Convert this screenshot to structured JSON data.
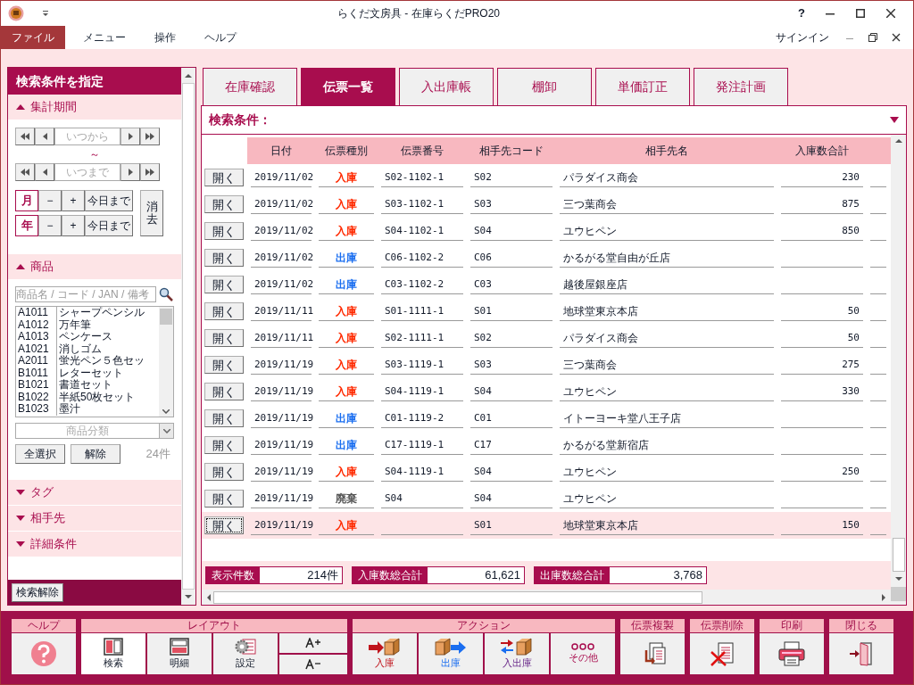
{
  "window": {
    "title": "らくだ文房具 - 在庫らくだPRO20",
    "help": "?"
  },
  "menu": [
    {
      "label": "ファイル",
      "selected": true
    },
    {
      "label": "メニュー",
      "selected": false
    },
    {
      "label": "操作",
      "selected": false
    },
    {
      "label": "ヘルプ",
      "selected": false
    }
  ],
  "signin": "サインイン",
  "sidebar": {
    "title": "検索条件を指定",
    "period": {
      "label": "集計期間",
      "expanded": true,
      "from_placeholder": "いつから",
      "tilde": "～",
      "to_placeholder": "いつまで",
      "units": [
        {
          "label": "月",
          "minus": "−",
          "plus": "+",
          "today": "今日まで"
        },
        {
          "label": "年",
          "minus": "−",
          "plus": "+",
          "today": "今日まで"
        }
      ],
      "clear": "消去"
    },
    "products": {
      "label": "商品",
      "expanded": true,
      "search_placeholder": "商品名 / コード / JAN / 備考",
      "items": [
        {
          "code": "A1011",
          "name": "シャープペンシル"
        },
        {
          "code": "A1012",
          "name": "万年筆"
        },
        {
          "code": "A1013",
          "name": "ペンケース"
        },
        {
          "code": "A1021",
          "name": "消しゴム"
        },
        {
          "code": "A2011",
          "name": "蛍光ペン５色セッ"
        },
        {
          "code": "B1011",
          "name": "レターセット"
        },
        {
          "code": "B1021",
          "name": "書道セット"
        },
        {
          "code": "B1022",
          "name": "半紙50枚セット"
        },
        {
          "code": "B1023",
          "name": "墨汁"
        }
      ],
      "category_placeholder": "商品分類",
      "select_all": "全選択",
      "deselect": "解除",
      "count": "24件"
    },
    "sections": [
      {
        "label": "タグ",
        "expanded": false
      },
      {
        "label": "相手先",
        "expanded": false
      },
      {
        "label": "詳細条件",
        "expanded": false
      }
    ],
    "reset": "検索解除"
  },
  "tabs": [
    {
      "label": "在庫確認",
      "selected": false
    },
    {
      "label": "伝票一覧",
      "selected": true
    },
    {
      "label": "入出庫帳",
      "selected": false
    },
    {
      "label": "棚卸",
      "selected": false
    },
    {
      "label": "単価訂正",
      "selected": false
    },
    {
      "label": "発注計画",
      "selected": false
    }
  ],
  "search_bar": {
    "label": "検索条件："
  },
  "table": {
    "columns": [
      "日付",
      "伝票種別",
      "伝票番号",
      "相手先コード",
      "相手先名",
      "入庫数合計"
    ],
    "rows": [
      {
        "open": "開く",
        "date": "2019/11/02",
        "type": "入庫",
        "kind": "in",
        "number": "S02-1102-1",
        "code": "S02",
        "name": "パラダイス商会",
        "qty": "230",
        "selected": false
      },
      {
        "open": "開く",
        "date": "2019/11/02",
        "type": "入庫",
        "kind": "in",
        "number": "S03-1102-1",
        "code": "S03",
        "name": "三つ葉商会",
        "qty": "875",
        "selected": false
      },
      {
        "open": "開く",
        "date": "2019/11/02",
        "type": "入庫",
        "kind": "in",
        "number": "S04-1102-1",
        "code": "S04",
        "name": "ユウヒペン",
        "qty": "850",
        "selected": false
      },
      {
        "open": "開く",
        "date": "2019/11/02",
        "type": "出庫",
        "kind": "out",
        "number": "C06-1102-2",
        "code": "C06",
        "name": "かるがる堂自由が丘店",
        "selected": false
      },
      {
        "open": "開く",
        "date": "2019/11/02",
        "type": "出庫",
        "kind": "out",
        "number": "C03-1102-2",
        "code": "C03",
        "name": "越後屋銀座店",
        "selected": false
      },
      {
        "open": "開く",
        "date": "2019/11/11",
        "type": "入庫",
        "kind": "in",
        "number": "S01-1111-1",
        "code": "S01",
        "name": "地球堂東京本店",
        "qty": "50",
        "selected": false
      },
      {
        "open": "開く",
        "date": "2019/11/11",
        "type": "入庫",
        "kind": "in",
        "number": "S02-1111-1",
        "code": "S02",
        "name": "パラダイス商会",
        "qty": "50",
        "selected": false
      },
      {
        "open": "開く",
        "date": "2019/11/19",
        "type": "入庫",
        "kind": "in",
        "number": "S03-1119-1",
        "code": "S03",
        "name": "三つ葉商会",
        "qty": "275",
        "selected": false
      },
      {
        "open": "開く",
        "date": "2019/11/19",
        "type": "入庫",
        "kind": "in",
        "number": "S04-1119-1",
        "code": "S04",
        "name": "ユウヒペン",
        "qty": "330",
        "selected": false
      },
      {
        "open": "開く",
        "date": "2019/11/19",
        "type": "出庫",
        "kind": "out",
        "number": "C01-1119-2",
        "code": "C01",
        "name": "イトーヨーキ堂八王子店",
        "selected": false
      },
      {
        "open": "開く",
        "date": "2019/11/19",
        "type": "出庫",
        "kind": "out",
        "number": "C17-1119-1",
        "code": "C17",
        "name": "かるがる堂新宿店",
        "selected": false
      },
      {
        "open": "開く",
        "date": "2019/11/19",
        "type": "入庫",
        "kind": "in",
        "number": "S04-1119-1",
        "code": "S04",
        "name": "ユウヒペン",
        "qty": "250",
        "selected": false
      },
      {
        "open": "開く",
        "date": "2019/11/19",
        "type": "廃棄",
        "kind": "discard",
        "number": "S04",
        "code": "S04",
        "name": "ユウヒペン",
        "selected": false
      },
      {
        "open": "開く",
        "date": "2019/11/19",
        "type": "入庫",
        "kind": "in",
        "code": "S01",
        "name": "地球堂東京本店",
        "qty": "150",
        "selected": true
      }
    ]
  },
  "totals": [
    {
      "label": "表示件数",
      "value": "214件"
    },
    {
      "label": "入庫数総合計",
      "value": "61,621"
    },
    {
      "label": "出庫数総合計",
      "value": "3,768"
    }
  ],
  "toolbar": [
    {
      "title": "ヘルプ",
      "buttons": [
        {
          "kind": "help"
        }
      ]
    },
    {
      "title": "レイアウト",
      "buttons": [
        {
          "kind": "search",
          "label": "検索",
          "selected": true
        },
        {
          "kind": "detail",
          "label": "明細",
          "selected": false
        },
        {
          "kind": "settings",
          "label": "設定",
          "selected": false
        },
        {
          "kind": "font"
        }
      ]
    },
    {
      "title": "アクション",
      "buttons": [
        {
          "kind": "in",
          "label": "入庫"
        },
        {
          "kind": "out",
          "label": "出庫"
        },
        {
          "kind": "inout",
          "label": "入出庫"
        },
        {
          "kind": "more",
          "label": "その他"
        }
      ]
    },
    {
      "title": "伝票複製",
      "buttons": [
        {
          "kind": "copy"
        }
      ]
    },
    {
      "title": "伝票削除",
      "buttons": [
        {
          "kind": "delete"
        }
      ]
    },
    {
      "title": "印刷",
      "buttons": [
        {
          "kind": "print"
        }
      ]
    },
    {
      "title": "閉じる",
      "buttons": [
        {
          "kind": "close"
        }
      ]
    }
  ]
}
